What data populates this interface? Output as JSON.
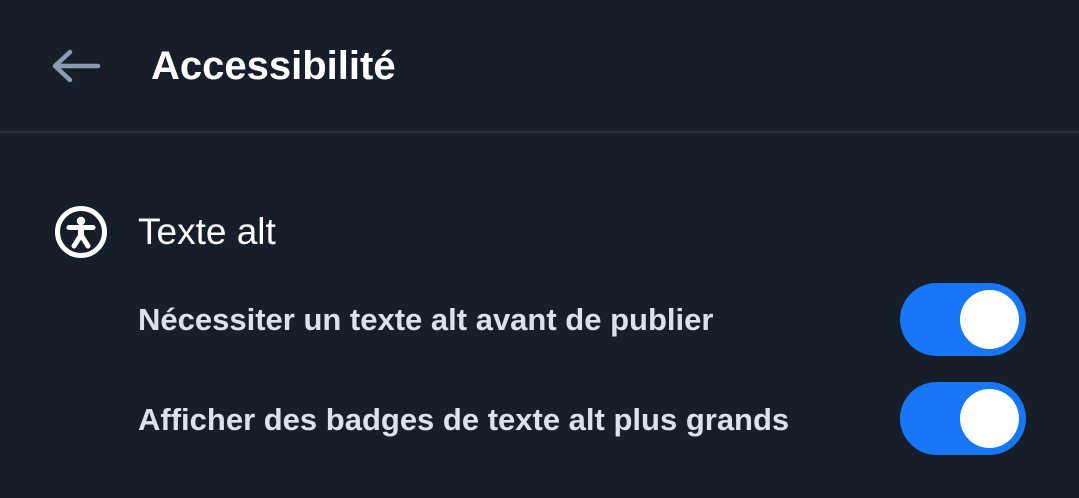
{
  "header": {
    "back_icon": "arrow-left-icon",
    "title": "Accessibilité"
  },
  "section": {
    "icon": "accessibility-icon",
    "title": "Texte alt"
  },
  "settings": [
    {
      "label": "Nécessiter un texte alt avant de publier",
      "enabled": true
    },
    {
      "label": "Afficher des badges de texte alt plus grands",
      "enabled": true
    }
  ],
  "colors": {
    "background": "#161e2a",
    "divider": "#26303d",
    "toggle_on": "#1877f6",
    "text_primary": "#ffffff",
    "text_secondary": "#dbe2ea",
    "back_icon": "#8b9bb4"
  }
}
